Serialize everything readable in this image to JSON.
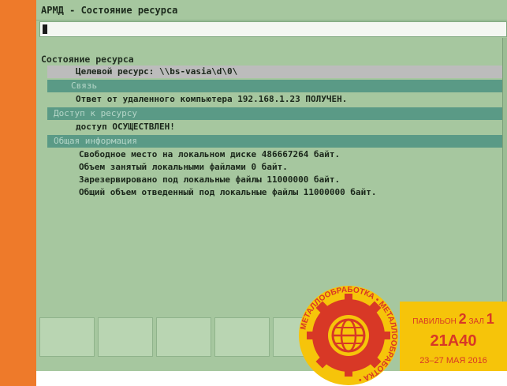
{
  "window": {
    "title": "АРМД - Состояние ресурса"
  },
  "main": {
    "section_title": "Состояние ресурса",
    "rows": [
      {
        "text": "Целевой ресурс: \\\\bs-vasia\\d\\0\\"
      },
      {
        "text": "Связь"
      },
      {
        "text": "Ответ от удаленного компьютера 192.168.1.23 ПОЛУЧЕН."
      },
      {
        "text": "Доступ к ресурсу"
      },
      {
        "text": "доступ ОСУЩЕСТВЛЕН!"
      },
      {
        "text": "Общая информация"
      },
      {
        "text": "Свободное место на локальном диске 486667264 байт."
      },
      {
        "text": "Объем занятый локальными файлами 0 байт."
      },
      {
        "text": "Зарезервировано под локальные файлы 11000000 байт."
      },
      {
        "text": "Общий объем отведенный под локальные файлы 11000000 байт."
      }
    ]
  },
  "badge": {
    "pavilion_label": "ПАВИЛЬОН",
    "pavilion_number": "2",
    "hall_label": "ЗАЛ",
    "hall_number": "1",
    "stand": "21А40",
    "dates": "23–27 МАЯ 2016"
  },
  "logo": {
    "text": "МЕТАЛЛООБРАБОТКА • МЕТАЛЛООБРАБОТКА •",
    "icon": "globe-gear-logo"
  },
  "colors": {
    "orange": "#ee7a2a",
    "screen": "#a6c79f",
    "band": "#5a9a86",
    "badge": "#f6c40a",
    "badge_text": "#d83826"
  }
}
